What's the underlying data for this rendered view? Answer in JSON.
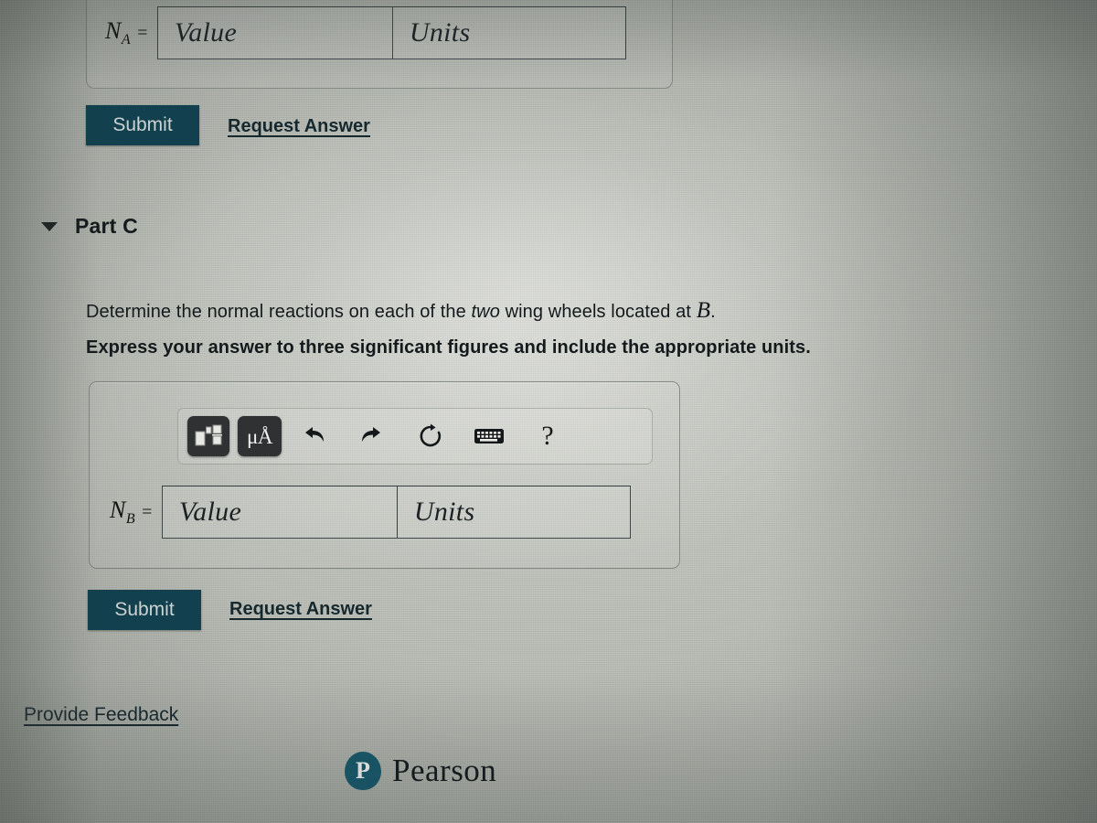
{
  "page": {
    "platform": "Pearson Mastering (photo of screen)"
  },
  "part_b_answer": {
    "variable_label": "N",
    "variable_sub": "A",
    "equals": "=",
    "value_placeholder": "Value",
    "units_placeholder": "Units",
    "submit_label": "Submit",
    "request_answer_label": "Request Answer"
  },
  "part_c": {
    "caret_icon": "triangle-down-icon",
    "title": "Part C",
    "prompt_before": "Determine the normal reactions on each of the ",
    "prompt_emphasis": "two",
    "prompt_after": " wing wheels located at ",
    "prompt_variable": "B",
    "prompt_end": ".",
    "instruction": "Express your answer to three significant figures and include the appropriate units.",
    "toolbar": {
      "template_button": "math-template-icon",
      "units_button_label": "μÅ",
      "undo_icon": "undo-icon",
      "redo_icon": "redo-icon",
      "reset_icon": "reset-icon",
      "keyboard_icon": "keyboard-icon",
      "help_label": "?"
    },
    "answer": {
      "variable_label": "N",
      "variable_sub": "B",
      "equals": "=",
      "value_placeholder": "Value",
      "units_placeholder": "Units"
    },
    "submit_label": "Submit",
    "request_answer_label": "Request Answer"
  },
  "footer": {
    "feedback_label": "Provide Feedback",
    "logo_letter": "P",
    "logo_wordmark": "Pearson"
  },
  "colors": {
    "submit_button": "#11404e",
    "link": "#15282e",
    "brand_teal": "#14566a",
    "toolbar_button": "#2f3133"
  }
}
